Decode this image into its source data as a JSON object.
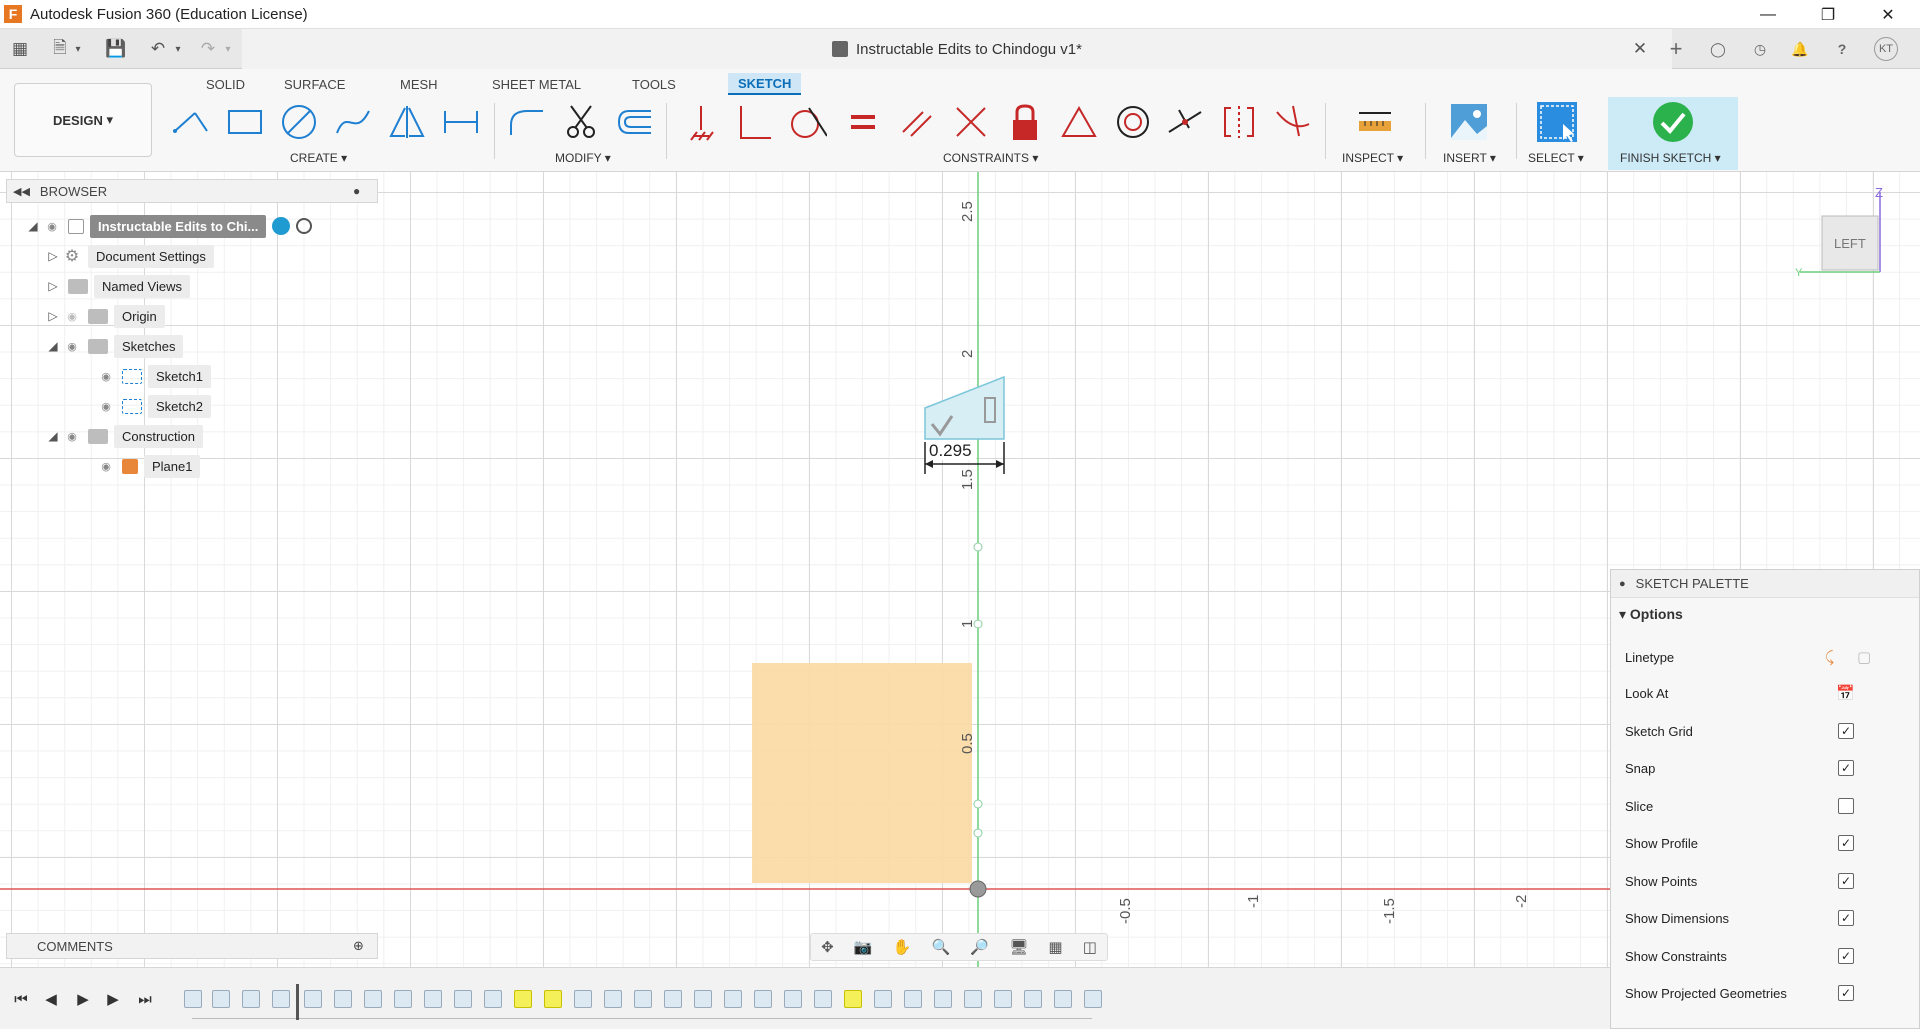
{
  "window": {
    "title": "Autodesk Fusion 360 (Education License)",
    "logo": "F"
  },
  "tabbar": {
    "document_title": "Instructable Edits to Chindogu v1*",
    "user_initials": "KT"
  },
  "toolbar": {
    "design_label": "DESIGN",
    "workspace_tabs": [
      "SOLID",
      "SURFACE",
      "MESH",
      "SHEET METAL",
      "TOOLS",
      "SKETCH"
    ],
    "groups": {
      "create": "CREATE",
      "modify": "MODIFY",
      "constraints": "CONSTRAINTS",
      "inspect": "INSPECT",
      "insert": "INSERT",
      "select": "SELECT",
      "finish": "FINISH SKETCH"
    }
  },
  "browser": {
    "header": "BROWSER",
    "items": [
      {
        "label": "Instructable Edits to Chi..."
      },
      {
        "label": "Document Settings"
      },
      {
        "label": "Named Views"
      },
      {
        "label": "Origin"
      },
      {
        "label": "Sketches"
      },
      {
        "label": "Sketch1"
      },
      {
        "label": "Sketch2"
      },
      {
        "label": "Construction"
      },
      {
        "label": "Plane1"
      }
    ]
  },
  "canvas": {
    "dimension_value": "0.295",
    "vertical_ticks": [
      "2.5",
      "2",
      "1.5",
      "1",
      "0.5"
    ],
    "horizontal_ticks": [
      "-0.5",
      "-1",
      "-1.5",
      "-2"
    ],
    "view_cube_face": "LEFT",
    "axis_labels": {
      "z": "Z",
      "y": "Y"
    }
  },
  "sketch_palette": {
    "header": "SKETCH PALETTE",
    "section": "Options",
    "options": [
      {
        "label": "Linetype",
        "type": "icons"
      },
      {
        "label": "Look At",
        "type": "icon"
      },
      {
        "label": "Sketch Grid",
        "type": "check",
        "checked": true
      },
      {
        "label": "Snap",
        "type": "check",
        "checked": true
      },
      {
        "label": "Slice",
        "type": "check",
        "checked": false
      },
      {
        "label": "Show Profile",
        "type": "check",
        "checked": true
      },
      {
        "label": "Show Points",
        "type": "check",
        "checked": true
      },
      {
        "label": "Show Dimensions",
        "type": "check",
        "checked": true
      },
      {
        "label": "Show Constraints",
        "type": "check",
        "checked": true
      },
      {
        "label": "Show Projected Geometries",
        "type": "check",
        "checked": true
      }
    ]
  },
  "comments": {
    "header": "COMMENTS"
  },
  "colors": {
    "accent": "#0b6eb8",
    "finish_green": "#2bb24c",
    "profile_fill": "#fbd9a2",
    "x_axis": "#e05555",
    "y_axis": "#6ccf7a"
  }
}
